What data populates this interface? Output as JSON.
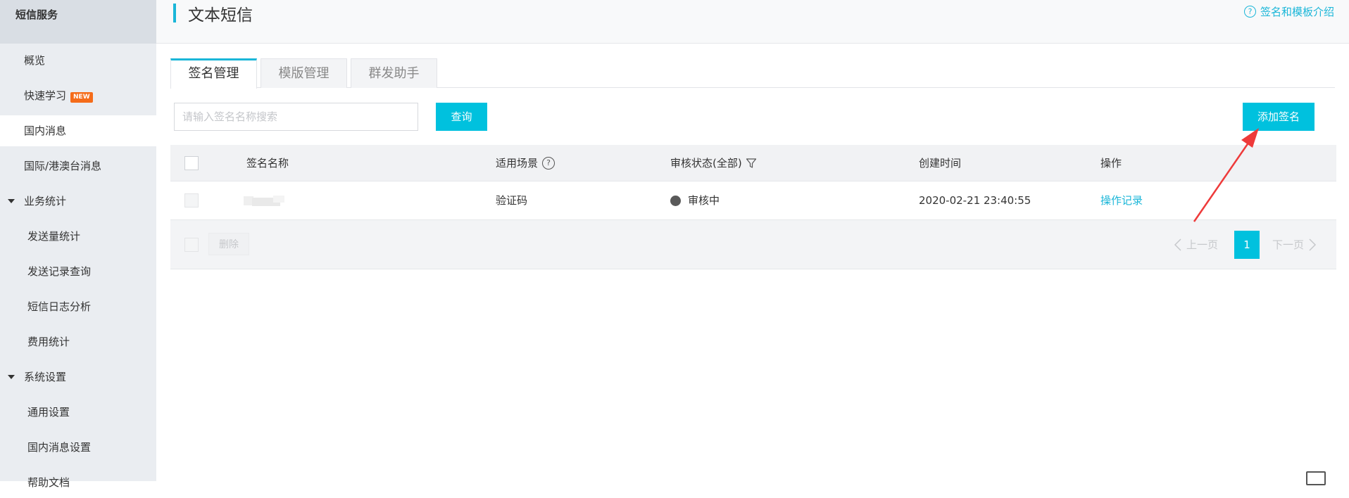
{
  "sidebar": {
    "title": "短信服务",
    "items": [
      {
        "label": "概览"
      },
      {
        "label": "快速学习",
        "badge": "NEW"
      },
      {
        "label": "国内消息"
      },
      {
        "label": "国际/港澳台消息"
      },
      {
        "label": "业务统计"
      },
      {
        "label": "发送量统计"
      },
      {
        "label": "发送记录查询"
      },
      {
        "label": "短信日志分析"
      },
      {
        "label": "费用统计"
      },
      {
        "label": "系统设置"
      },
      {
        "label": "通用设置"
      },
      {
        "label": "国内消息设置"
      },
      {
        "label": "帮助文档"
      }
    ]
  },
  "header": {
    "title": "文本短信",
    "help_link": "签名和模板介绍"
  },
  "tabs": [
    {
      "label": "签名管理"
    },
    {
      "label": "模版管理"
    },
    {
      "label": "群发助手"
    }
  ],
  "toolbar": {
    "search_placeholder": "请输入签名名称搜索",
    "search_button": "查询",
    "add_button": "添加签名"
  },
  "table": {
    "columns": [
      "签名名称",
      "适用场景",
      "审核状态(全部)",
      "创建时间",
      "操作"
    ],
    "rows": [
      {
        "name": "",
        "scene": "验证码",
        "status": "审核中",
        "created": "2020-02-21 23:40:55",
        "action": "操作记录"
      }
    ]
  },
  "footer": {
    "delete_button": "删除",
    "prev": "上一页",
    "page": "1",
    "next": "下一页"
  },
  "colors": {
    "accent": "#00c1de",
    "link": "#1ab6d8",
    "annotation_arrow": "#ee3a3a"
  }
}
